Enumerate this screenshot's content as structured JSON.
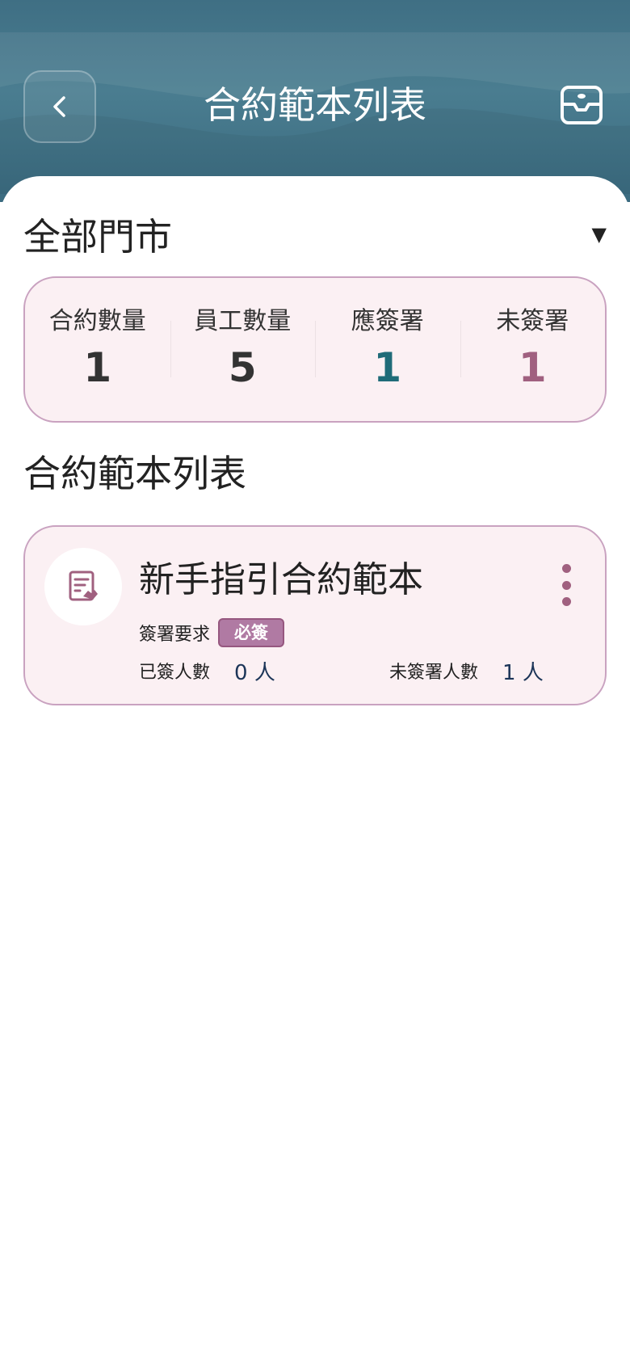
{
  "header": {
    "title": "合約範本列表",
    "back_icon": "chevron-left-icon",
    "inbox_icon": "inbox-icon"
  },
  "store_selector": {
    "label": "全部門市",
    "caret": "▼"
  },
  "stats": [
    {
      "label": "合約數量",
      "value": "1",
      "color": "#333333"
    },
    {
      "label": "員工數量",
      "value": "5",
      "color": "#333333"
    },
    {
      "label": "應簽署",
      "value": "1",
      "color": "#1f6b78"
    },
    {
      "label": "未簽署",
      "value": "1",
      "color": "#a0607f"
    }
  ],
  "section": {
    "title": "合約範本列表"
  },
  "contracts": [
    {
      "title": "新手指引合約範本",
      "requirement_label": "簽署要求",
      "requirement_badge": "必簽",
      "signed_label": "已簽人數",
      "signed_value": "0 人",
      "unsigned_label": "未簽署人數",
      "unsigned_value": "1 人"
    }
  ],
  "colors": {
    "accent_teal": "#1f6b78",
    "accent_mauve": "#a0607f",
    "card_bg": "#fbf0f3",
    "card_border": "#c9a2c0"
  }
}
